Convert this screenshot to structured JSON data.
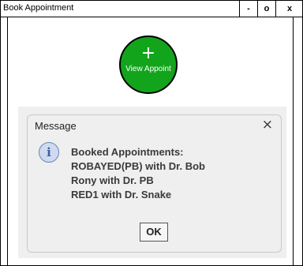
{
  "window": {
    "title": "Book Appointment",
    "controls": {
      "minimize": "-",
      "maximize": "o",
      "close": "x"
    }
  },
  "fab": {
    "icon": "plus-icon",
    "plus": "+",
    "label": "View Appoint",
    "color": "#12a51c"
  },
  "dialog": {
    "title": "Message",
    "close": "×",
    "info_icon": "i",
    "lines": [
      "Booked Appointments:",
      "ROBAYED(PB) with Dr. Bob",
      "Rony with Dr. PB",
      "RED1 with Dr. Snake"
    ],
    "ok_label": "OK"
  }
}
